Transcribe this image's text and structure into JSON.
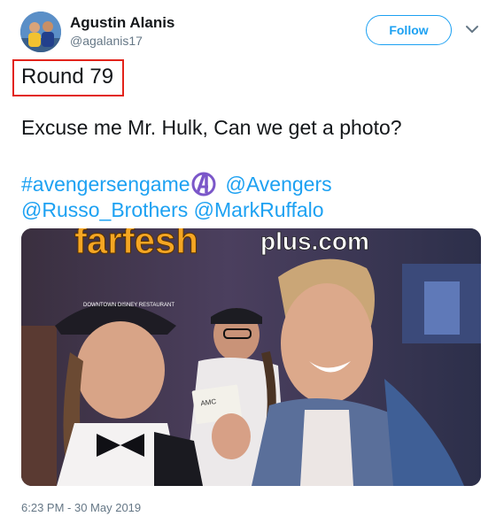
{
  "user": {
    "name": "Agustin Alanis",
    "handle": "@agalanis17"
  },
  "follow_label": "Follow",
  "highlight_text": "Round 79",
  "tweet_text": "Excuse me Mr. Hulk, Can we get a photo?",
  "hashtag": "#avengersengame",
  "mentions": [
    "@Avengers",
    "@Russo_Brothers",
    "@MarkRuffalo"
  ],
  "photo": {
    "watermark_part1": "farfesh",
    "watermark_part2": "plus.com",
    "cap_text": "DOWNTOWN DISNEY RESTAURANT",
    "ticket_text": "AMC"
  },
  "timestamp": "6:23 PM - 30 May 2019",
  "colors": {
    "link": "#1da1f2",
    "highlight_border": "#e2231a",
    "muted": "#657786",
    "watermark_orange": "#f5a623"
  },
  "icons": [
    "avatar",
    "avengers-logo-icon",
    "chevron-down-icon"
  ]
}
